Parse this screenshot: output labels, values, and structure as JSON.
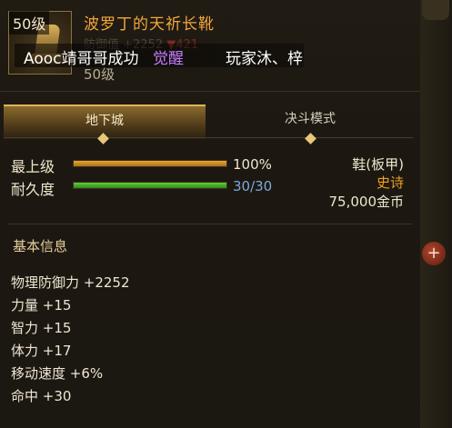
{
  "item": {
    "level_badge": "50级",
    "name": "波罗丁的天祈长靴",
    "ghost_line": "防御值 +2252",
    "ghost_delta": "▼421",
    "sub_level": "50级"
  },
  "broadcast": {
    "part1": "Aooc靖哥哥成功",
    "part2": "觉醒",
    "part3": "玩家沐、梓"
  },
  "tabs": [
    {
      "label": "地下城",
      "active": true
    },
    {
      "label": "决斗模式",
      "active": false
    }
  ],
  "stats": {
    "grade_label": "最上级",
    "grade_value": "100%",
    "grade_fraction": 1.0,
    "durability_label": "耐久度",
    "durability_value": "30/30",
    "durability_fraction": 1.0
  },
  "info": {
    "slot": "鞋(板甲)",
    "rarity": "史诗",
    "price": "75,000金币"
  },
  "basic_info": {
    "title": "基本信息",
    "attributes": [
      "物理防御力 +2252",
      "力量 +15",
      "智力 +15",
      "体力 +17",
      "移动速度 +6%",
      "命中 +30"
    ]
  },
  "colors": {
    "name": "#f3a63a",
    "rarity": "#f0a020",
    "grade_bar": "#e8a632",
    "durability_bar": "#5fcf3a",
    "durability_text": "#7ea8d8",
    "awaken": "#c57bff"
  }
}
